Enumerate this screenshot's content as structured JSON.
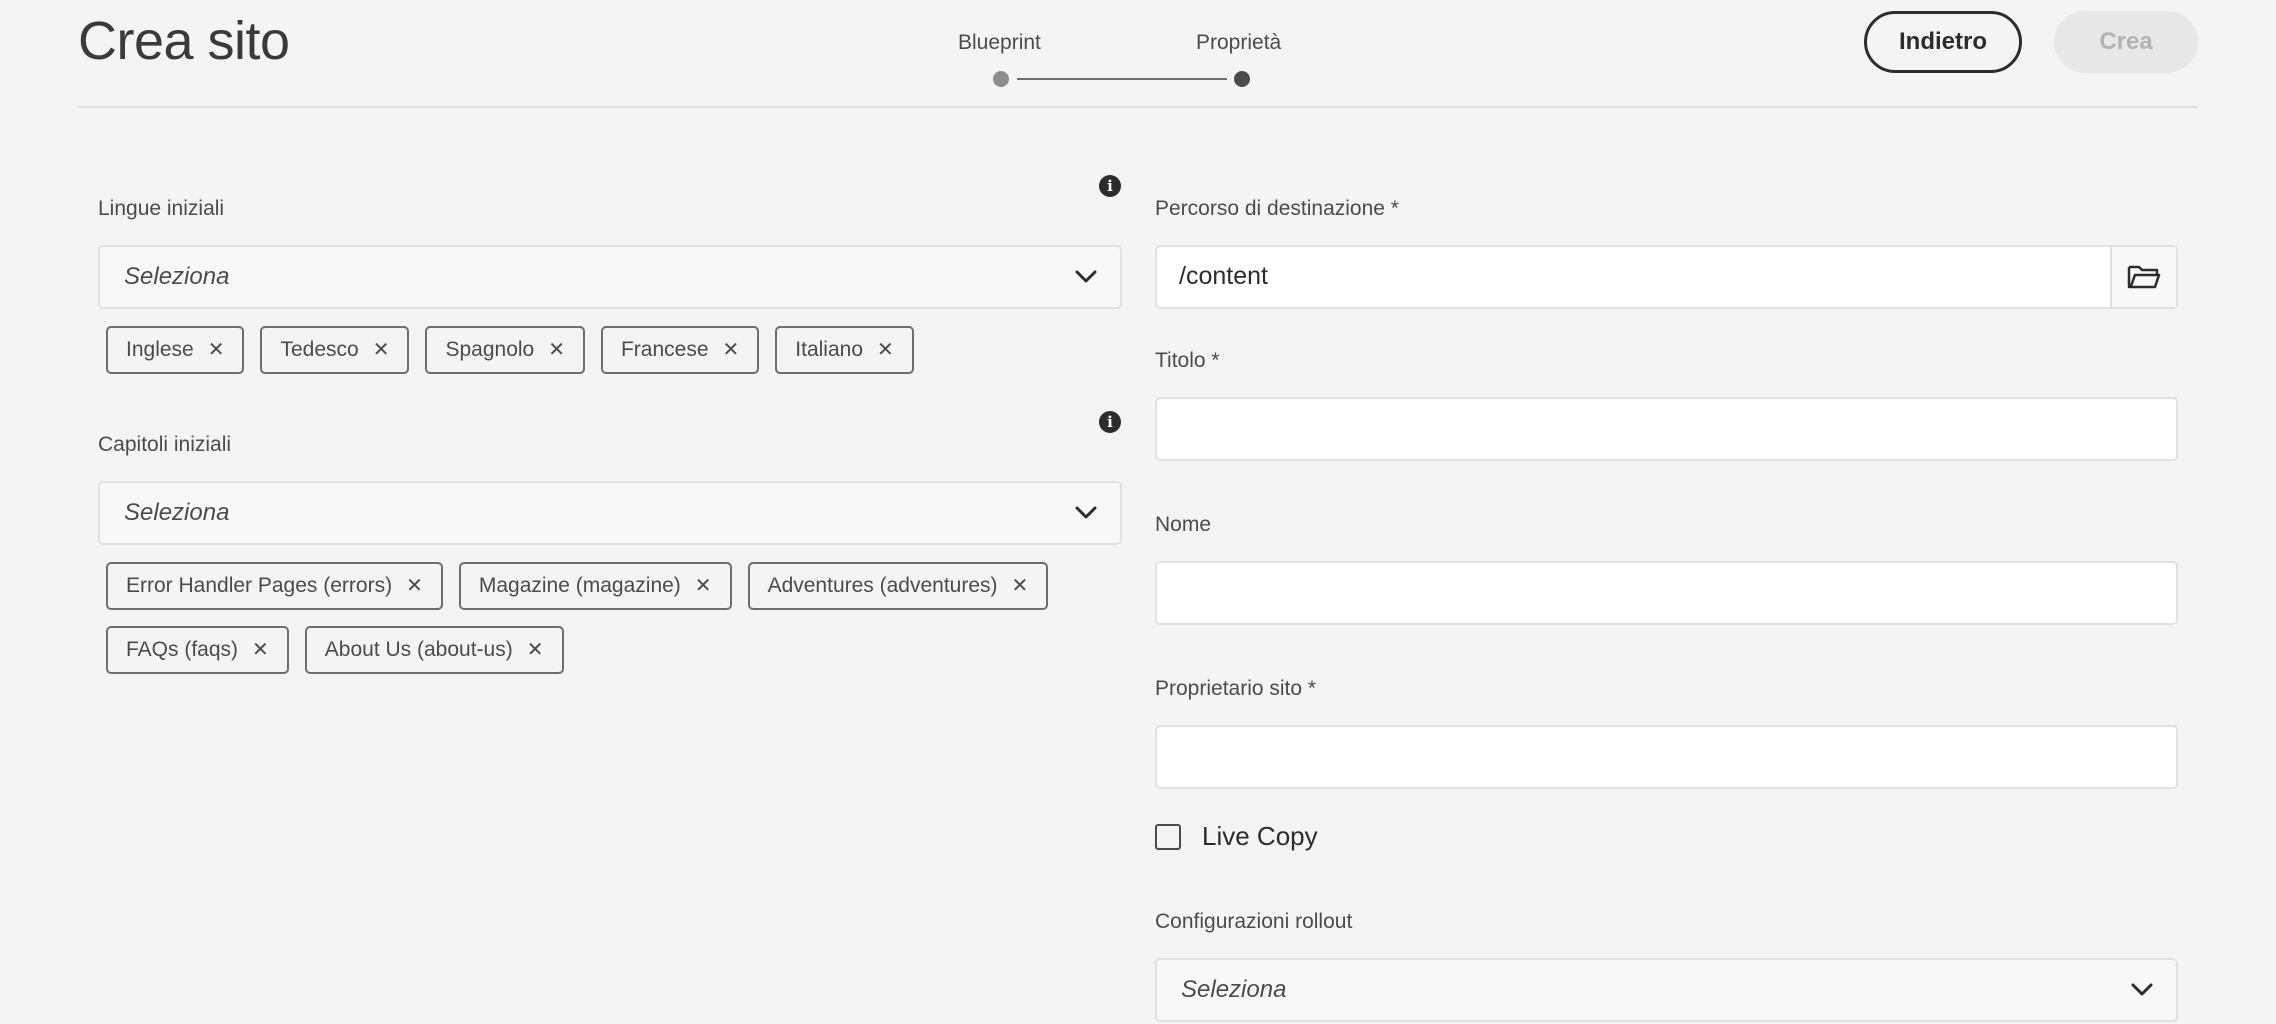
{
  "header": {
    "title": "Crea sito",
    "steps": [
      "Blueprint",
      "Proprietà"
    ],
    "back_label": "Indietro",
    "create_label": "Crea"
  },
  "languages": {
    "label": "Lingue iniziali",
    "placeholder": "Seleziona",
    "tags": [
      "Inglese",
      "Tedesco",
      "Spagnolo",
      "Francese",
      "Italiano"
    ]
  },
  "chapters": {
    "label": "Capitoli iniziali",
    "placeholder": "Seleziona",
    "tags": [
      "Error Handler Pages (errors)",
      "Magazine (magazine)",
      "Adventures (adventures)",
      "FAQs (faqs)",
      "About Us (about-us)"
    ]
  },
  "destination": {
    "label": "Percorso di destinazione *",
    "value": "/content"
  },
  "title_field": {
    "label": "Titolo *",
    "value": ""
  },
  "name_field": {
    "label": "Nome",
    "value": ""
  },
  "owner_field": {
    "label": "Proprietario sito *",
    "value": ""
  },
  "live_copy": {
    "label": "Live Copy",
    "checked": false
  },
  "rollout": {
    "label": "Configurazioni rollout",
    "placeholder": "Seleziona"
  },
  "icons": {
    "info": "info-icon",
    "remove": "close-icon",
    "dropdown": "chevron-down-icon",
    "browse": "folder-icon"
  }
}
